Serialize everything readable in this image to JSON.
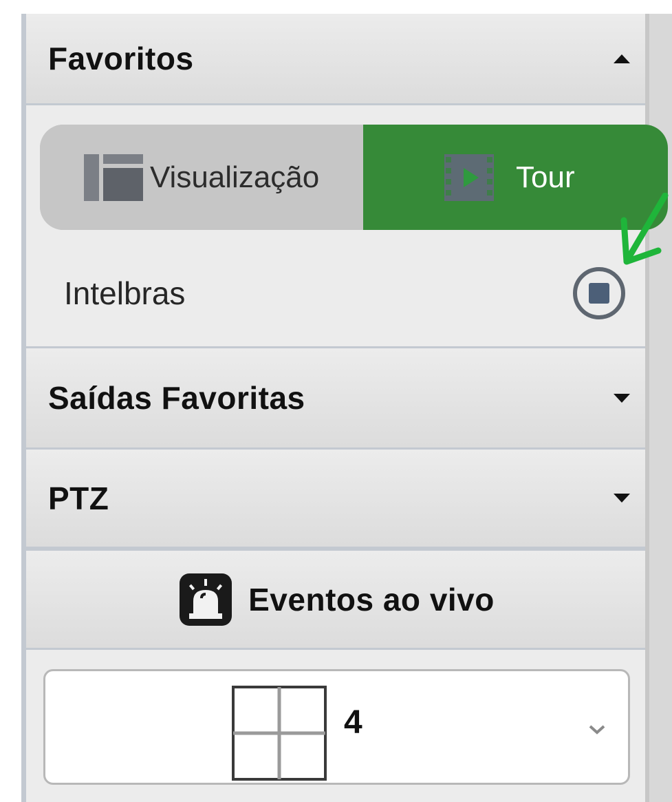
{
  "favoritos": {
    "title": "Favoritos",
    "expand_icon": "triangle-up-icon",
    "toggle": {
      "visualizacao_label": "Visualização",
      "visualizacao_icon": "layout-view-icon",
      "tour_label": "Tour",
      "tour_icon": "film-play-icon",
      "selected": "Tour"
    },
    "items": [
      {
        "name": "Intelbras",
        "action_icon": "stop-circle-icon"
      }
    ]
  },
  "saidas_favoritas": {
    "title": "Saídas Favoritas",
    "expand_icon": "triangle-down-icon"
  },
  "ptz": {
    "title": "PTZ",
    "expand_icon": "triangle-down-icon"
  },
  "eventos": {
    "label": "Eventos ao vivo",
    "icon": "alarm-siren-icon"
  },
  "layout_selector": {
    "value": "4",
    "icon": "grid-2x2-icon",
    "dropdown_icon": "chevron-down-icon"
  },
  "colors": {
    "tour_active": "#368a38",
    "annotation_arrow": "#1fb53a",
    "panel_bg": "#ececec",
    "divider": "#c3c9d1"
  }
}
